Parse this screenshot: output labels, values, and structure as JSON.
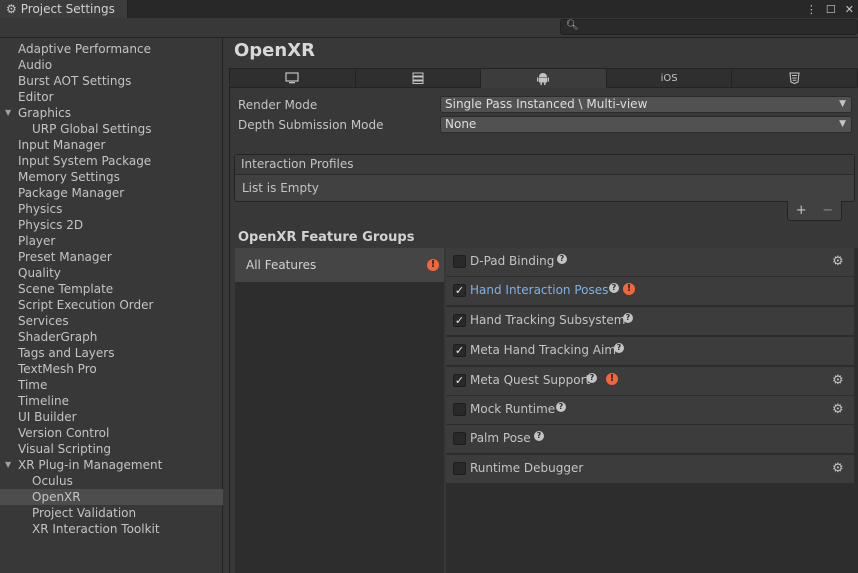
{
  "window": {
    "title": "Project Settings",
    "icons": {
      "more": "more-vert-icon",
      "maximize": "maximize-icon",
      "close": "close-icon"
    }
  },
  "search": {
    "placeholder": ""
  },
  "sidebar": {
    "items": [
      {
        "label": "Adaptive Performance"
      },
      {
        "label": "Audio"
      },
      {
        "label": "Burst AOT Settings"
      },
      {
        "label": "Editor"
      },
      {
        "label": "Graphics"
      },
      {
        "label": "URP Global Settings"
      },
      {
        "label": "Input Manager"
      },
      {
        "label": "Input System Package"
      },
      {
        "label": "Memory Settings"
      },
      {
        "label": "Package Manager"
      },
      {
        "label": "Physics"
      },
      {
        "label": "Physics 2D"
      },
      {
        "label": "Player"
      },
      {
        "label": "Preset Manager"
      },
      {
        "label": "Quality"
      },
      {
        "label": "Scene Template"
      },
      {
        "label": "Script Execution Order"
      },
      {
        "label": "Services"
      },
      {
        "label": "ShaderGraph"
      },
      {
        "label": "Tags and Layers"
      },
      {
        "label": "TextMesh Pro"
      },
      {
        "label": "Time"
      },
      {
        "label": "Timeline"
      },
      {
        "label": "UI Builder"
      },
      {
        "label": "Version Control"
      },
      {
        "label": "Visual Scripting"
      },
      {
        "label": "XR Plug-in Management"
      },
      {
        "label": "Oculus"
      },
      {
        "label": "OpenXR"
      },
      {
        "label": "Project Validation"
      },
      {
        "label": "XR Interaction Toolkit"
      }
    ],
    "selected": "OpenXR"
  },
  "main": {
    "title": "OpenXR",
    "tabs": [
      {
        "icon": "desktop-icon",
        "label": ""
      },
      {
        "icon": "server-icon",
        "label": ""
      },
      {
        "icon": "android-icon",
        "label": ""
      },
      {
        "icon": "ios-tab",
        "label": "iOS"
      },
      {
        "icon": "html5-icon",
        "label": ""
      }
    ],
    "active_tab": "android",
    "render_mode": {
      "label": "Render Mode",
      "value": "Single Pass Instanced \\ Multi-view"
    },
    "depth_mode": {
      "label": "Depth Submission Mode",
      "value": "None"
    },
    "profiles": {
      "header": "Interaction Profiles",
      "empty_text": "List is Empty",
      "add": "+",
      "remove": "−"
    },
    "groups": {
      "title": "OpenXR Feature Groups",
      "all_features": "All Features",
      "features": [
        {
          "label": "D-Pad Binding",
          "checked": false,
          "warning": false,
          "settings": true,
          "highlight": false
        },
        {
          "label": "Hand Interaction Poses",
          "checked": true,
          "warning": true,
          "settings": false,
          "highlight": true
        },
        {
          "label": "Hand Tracking Subsystem",
          "checked": true,
          "warning": false,
          "settings": false,
          "highlight": false
        },
        {
          "label": "Meta Hand Tracking Aim",
          "checked": true,
          "warning": false,
          "settings": false,
          "highlight": false
        },
        {
          "label": "Meta Quest Support",
          "checked": true,
          "warning": true,
          "settings": true,
          "highlight": false
        },
        {
          "label": "Mock Runtime",
          "checked": false,
          "warning": false,
          "settings": true,
          "highlight": false
        },
        {
          "label": "Palm Pose",
          "checked": false,
          "warning": false,
          "settings": false,
          "highlight": false
        },
        {
          "label": "Runtime Debugger",
          "checked": false,
          "warning": false,
          "settings": true,
          "highlight": false
        }
      ]
    },
    "colors": {
      "warning": "#f4653c",
      "link_blue": "#7eb1e8"
    }
  }
}
